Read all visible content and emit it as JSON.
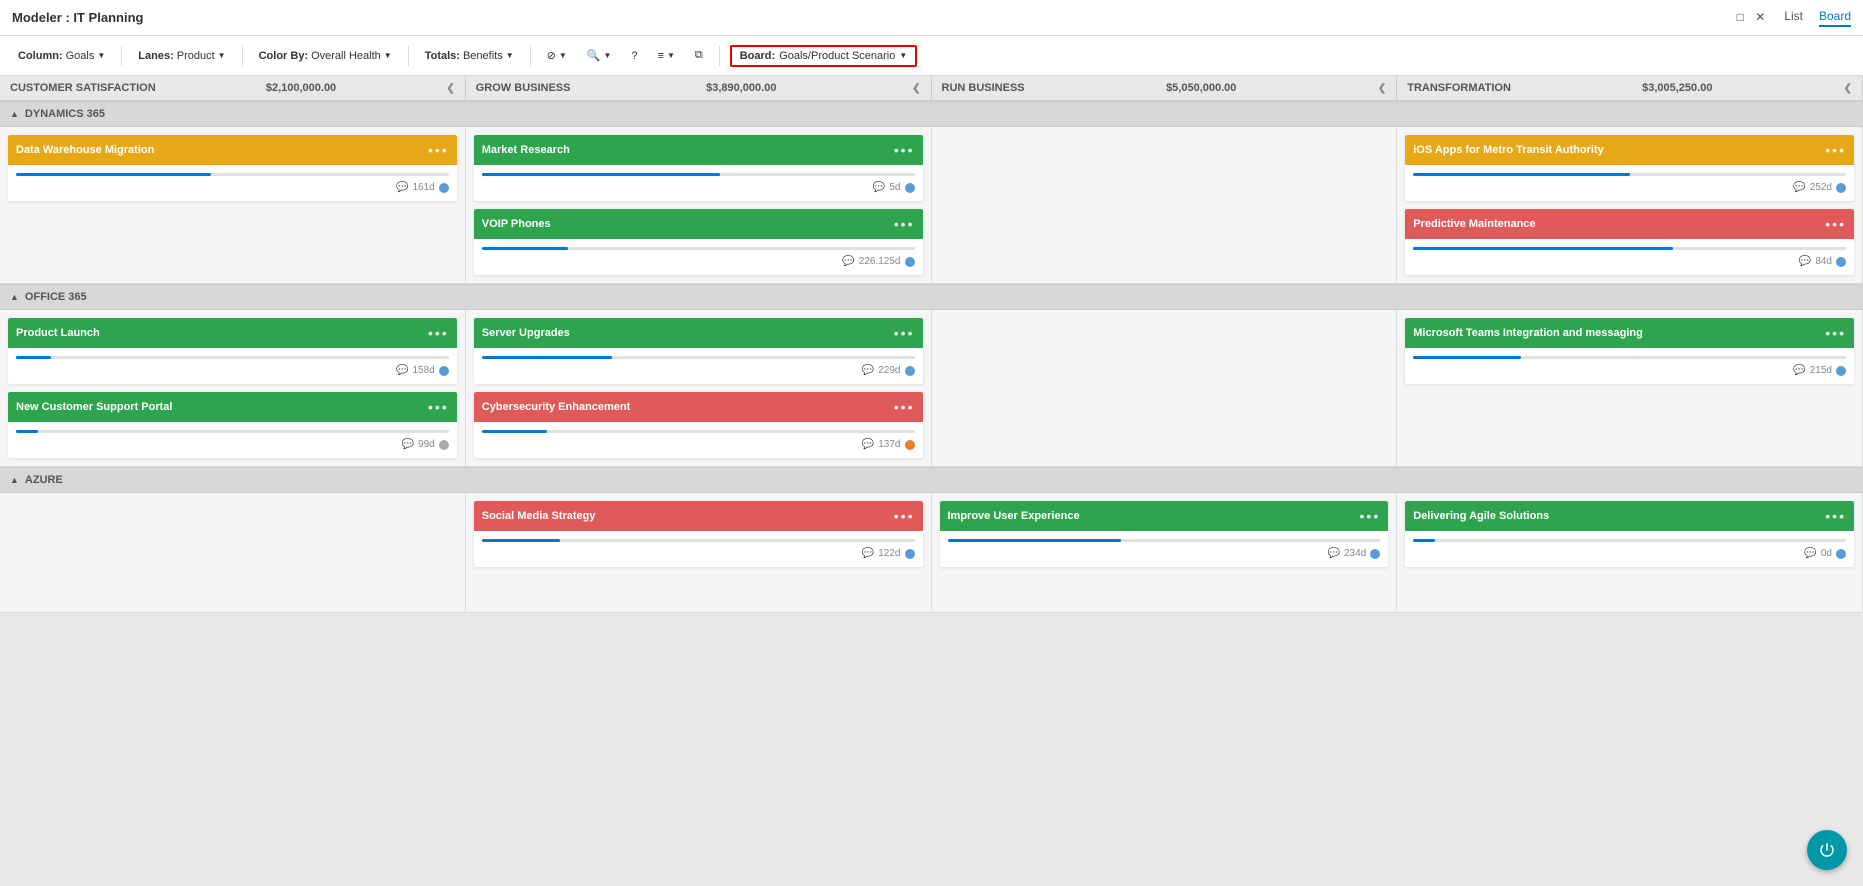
{
  "app": {
    "title": "Modeler : IT Planning",
    "view_list": "List",
    "view_board": "Board"
  },
  "toolbar": {
    "column_label": "Column:",
    "column_value": "Goals",
    "lanes_label": "Lanes:",
    "lanes_value": "Product",
    "color_label": "Color By:",
    "color_value": "Overall Health",
    "totals_label": "Totals:",
    "totals_value": "Benefits",
    "board_label": "Board:",
    "board_value": "Goals/Product Scenario"
  },
  "columns": [
    {
      "id": "customer-satisfaction",
      "label": "CUSTOMER SATISFACTION",
      "amount": "$2,100,000.00"
    },
    {
      "id": "grow-business",
      "label": "GROW BUSINESS",
      "amount": "$3,890,000.00"
    },
    {
      "id": "run-business",
      "label": "RUN BUSINESS",
      "amount": "$5,050,000.00"
    },
    {
      "id": "transformation",
      "label": "TRANSFORMATION",
      "amount": "$3,005,250.00"
    }
  ],
  "lanes": [
    {
      "id": "dynamics365",
      "label": "DYNAMICS 365",
      "cells": [
        [
          {
            "id": "data-warehouse",
            "title": "Data Warehouse Migration",
            "color": "bg-yellow",
            "progress": 45,
            "days": "161d",
            "dot": "dot-blue"
          }
        ],
        [
          {
            "id": "market-research",
            "title": "Market Research",
            "color": "bg-green",
            "progress": 55,
            "days": "5d",
            "dot": "dot-blue"
          },
          {
            "id": "voip-phones",
            "title": "VOIP Phones",
            "color": "bg-green",
            "progress": 20,
            "days": "226.125d",
            "dot": "dot-blue"
          }
        ],
        [],
        [
          {
            "id": "ios-apps",
            "title": "iOS Apps for Metro Transit Authority",
            "color": "bg-yellow",
            "progress": 50,
            "days": "252d",
            "dot": "dot-blue"
          },
          {
            "id": "predictive-maintenance",
            "title": "Predictive Maintenance",
            "color": "bg-red",
            "progress": 60,
            "days": "84d",
            "dot": "dot-blue"
          }
        ]
      ]
    },
    {
      "id": "office365",
      "label": "OFFICE 365",
      "cells": [
        [
          {
            "id": "product-launch",
            "title": "Product Launch",
            "color": "bg-green",
            "progress": 8,
            "days": "158d",
            "dot": "dot-blue"
          },
          {
            "id": "new-customer-support",
            "title": "New Customer Support Portal",
            "color": "bg-green",
            "progress": 5,
            "days": "99d",
            "dot": "dot-gray"
          }
        ],
        [
          {
            "id": "server-upgrades",
            "title": "Server Upgrades",
            "color": "bg-green",
            "progress": 30,
            "days": "229d",
            "dot": "dot-blue"
          },
          {
            "id": "cybersecurity",
            "title": "Cybersecurity Enhancement",
            "color": "bg-red",
            "progress": 15,
            "days": "137d",
            "dot": "dot-orange"
          }
        ],
        [],
        [
          {
            "id": "ms-teams",
            "title": "Microsoft Teams Integration and messaging",
            "color": "bg-green",
            "progress": 25,
            "days": "215d",
            "dot": "dot-blue"
          }
        ]
      ]
    },
    {
      "id": "azure",
      "label": "AZURE",
      "cells": [
        [],
        [
          {
            "id": "social-media",
            "title": "Social Media Strategy",
            "color": "bg-red",
            "progress": 18,
            "days": "122d",
            "dot": "dot-blue"
          }
        ],
        [
          {
            "id": "improve-ux",
            "title": "Improve User Experience",
            "color": "bg-green",
            "progress": 40,
            "days": "234d",
            "dot": "dot-blue"
          }
        ],
        [
          {
            "id": "delivering-agile",
            "title": "Delivering Agile Solutions",
            "color": "bg-green",
            "progress": 5,
            "days": "0d",
            "dot": "dot-blue"
          }
        ]
      ]
    }
  ]
}
